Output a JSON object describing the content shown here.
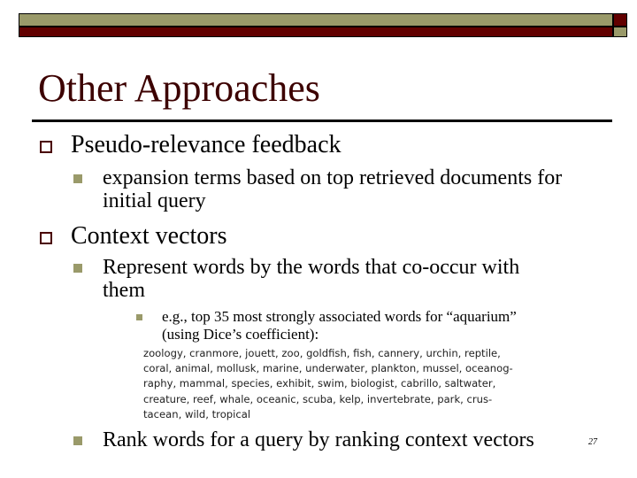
{
  "colors": {
    "accent_olive": "#9a9a6a",
    "accent_maroon": "#620000",
    "title": "#3c0000"
  },
  "slide": {
    "title": "Other Approaches",
    "page_number": "27",
    "bullets": [
      {
        "icon": "hollow-square-bullet",
        "text": "Pseudo-relevance feedback",
        "children": [
          {
            "icon": "filled-square-bullet",
            "lines": [
              "expansion terms based on top retrieved documents for",
              "initial query"
            ]
          }
        ]
      },
      {
        "icon": "hollow-square-bullet",
        "text": "Context vectors",
        "children": [
          {
            "icon": "filled-square-bullet",
            "lines": [
              "Represent words by the words that co-occur with",
              "them"
            ],
            "children": [
              {
                "icon": "filled-square-bullet",
                "lines": [
                  "e.g., top 35 most strongly associated words for “aquarium”",
                  "(using Dice’s coefficient):"
                ]
              }
            ]
          },
          {
            "icon": "filled-square-bullet",
            "lines": [
              "Rank words for a query by ranking context vectors"
            ]
          }
        ]
      }
    ],
    "word_list_lines": [
      "zoology, cranmore, jouett, zoo, goldfish, fish, cannery, urchin, reptile,",
      "coral, animal, mollusk, marine, underwater, plankton, mussel, oceanog-",
      "raphy, mammal, species, exhibit, swim, biologist, cabrillo, saltwater,",
      "creature, reef, whale, oceanic, scuba, kelp, invertebrate, park, crus-",
      "tacean, wild, tropical"
    ]
  }
}
